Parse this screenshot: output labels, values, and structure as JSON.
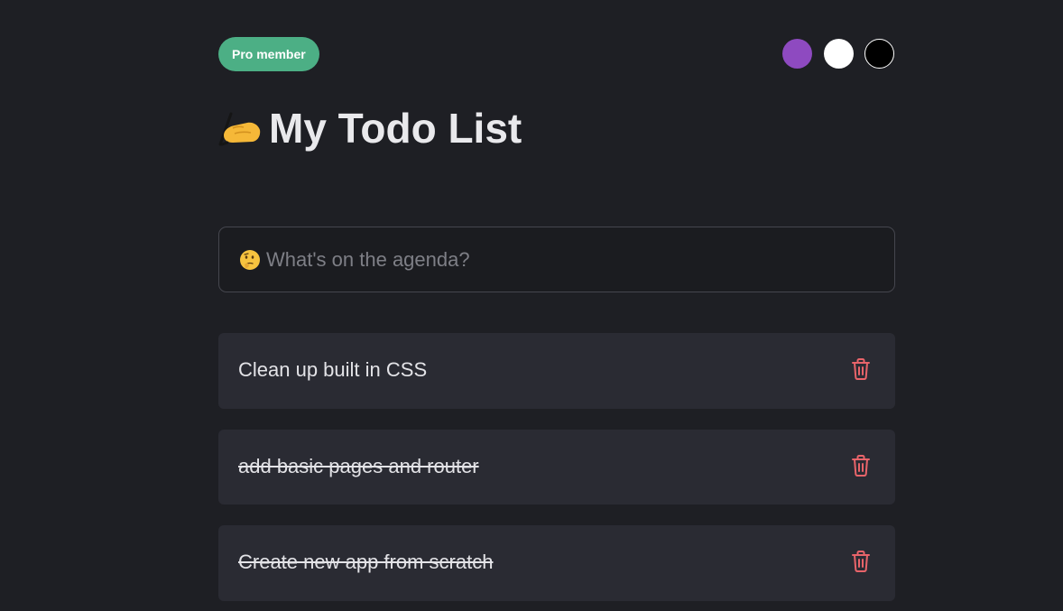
{
  "header": {
    "badge_label": "Pro member",
    "theme_swatches": [
      {
        "name": "purple",
        "color": "#8e4ac0"
      },
      {
        "name": "white",
        "color": "#ffffff"
      },
      {
        "name": "black",
        "color": "#000000"
      }
    ]
  },
  "title": {
    "emoji_icon": "writing-hand-icon",
    "text": "My Todo List"
  },
  "new_todo": {
    "emoji_icon": "thinking-face-icon",
    "placeholder": "What's on the agenda?",
    "value": ""
  },
  "todos": [
    {
      "text": "Clean up built in CSS",
      "completed": false
    },
    {
      "text": "add basic pages and router",
      "completed": true
    },
    {
      "text": "Create new app from scratch",
      "completed": true
    }
  ],
  "colors": {
    "background": "#1e1f24",
    "card": "#2a2b33",
    "accent_green": "#4caf85",
    "delete_red": "#e8646a"
  }
}
